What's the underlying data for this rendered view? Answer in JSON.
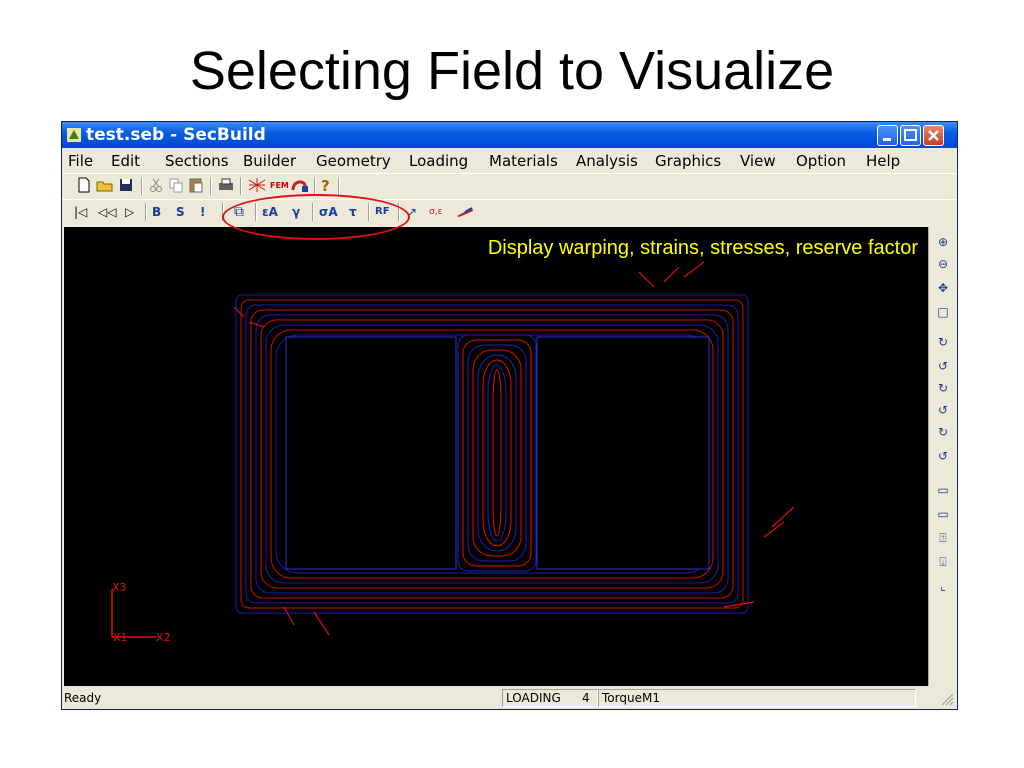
{
  "slide": {
    "title": "Selecting Field to Visualize"
  },
  "window": {
    "title": "test.seb - SecBuild",
    "controls": {
      "minimize": "minimize-icon",
      "maximize": "maximize-icon",
      "close": "close-icon"
    }
  },
  "menu": [
    "File",
    "Edit",
    "Sections",
    "Builder",
    "Geometry",
    "Loading",
    "Materials",
    "Analysis",
    "Graphics",
    "View",
    "Option",
    "Help"
  ],
  "toolbar1": {
    "icons": [
      "new-file-icon",
      "open-folder-icon",
      "save-icon",
      "cut-icon",
      "copy-icon",
      "paste-icon",
      "print-icon",
      "mesh-icon",
      "fem-icon",
      "solver-icon",
      "help-icon"
    ],
    "fem_label": "FEM",
    "help_label": "?"
  },
  "toolbar2": {
    "nav": [
      "|◁",
      "◁◁",
      "▷"
    ],
    "section_buttons": [
      "B",
      "S",
      "!"
    ],
    "field_buttons": {
      "warping": "⧉",
      "strain": "εA",
      "gamma": "γ",
      "stress": "σA",
      "tau": "τ",
      "reserve": "RF"
    },
    "extra": [
      "↗",
      "σ,ε"
    ]
  },
  "canvas": {
    "annotation": "Display warping, strains, stresses, reserve factor",
    "axes": {
      "x3": "X3",
      "x1": "X1",
      "x2": "X2"
    },
    "colors": {
      "background": "#000000",
      "mesh": "#2020c0",
      "arrows": "#e01010",
      "annotation": "#ffff00"
    }
  },
  "right_toolbar": [
    "zoom-in-icon",
    "zoom-out-icon",
    "pan-icon",
    "fit-icon",
    "rotate-x-pos-icon",
    "rotate-x-neg-icon",
    "rotate-y-pos-icon",
    "rotate-y-neg-icon",
    "rotate-z-pos-icon",
    "rotate-z-neg-icon",
    "move-right-icon",
    "move-left-icon",
    "move-up-icon",
    "move-down-icon",
    "axis-view-icon"
  ],
  "status": {
    "left": "Ready",
    "mode": "LOADING",
    "case_number": "4",
    "case_name": "TorqueM1"
  }
}
